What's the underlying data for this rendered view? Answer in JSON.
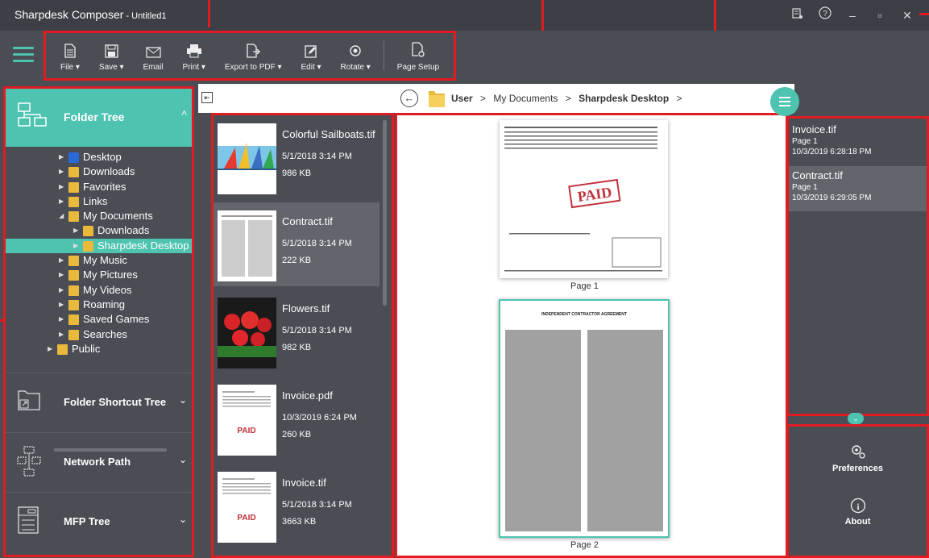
{
  "window": {
    "app_name": "Sharpdesk Composer",
    "doc_name": "- Untitled1",
    "controls": [
      "license-icon",
      "help-icon",
      "minimize-icon",
      "maximize-icon",
      "close-icon"
    ]
  },
  "toolbar": {
    "buttons": [
      {
        "label": "File ▾",
        "icon": "file-icon"
      },
      {
        "label": "Save ▾",
        "icon": "save-icon"
      },
      {
        "label": "Email",
        "icon": "email-icon"
      },
      {
        "label": "Print ▾",
        "icon": "print-icon"
      },
      {
        "label": "Export to PDF ▾",
        "icon": "export-pdf-icon"
      },
      {
        "label": "Edit ▾",
        "icon": "edit-icon"
      },
      {
        "label": "Rotate ▾",
        "icon": "rotate-icon"
      },
      {
        "label": "Page Setup",
        "icon": "page-setup-icon"
      }
    ]
  },
  "left_panel": {
    "folder_tree_label": "Folder Tree",
    "tree": [
      {
        "label": "Desktop",
        "level": 1,
        "selected": false
      },
      {
        "label": "Downloads",
        "level": 1,
        "selected": false
      },
      {
        "label": "Favorites",
        "level": 1,
        "selected": false
      },
      {
        "label": "Links",
        "level": 1,
        "selected": false
      },
      {
        "label": "My Documents",
        "level": 1,
        "selected": false,
        "expanded": true
      },
      {
        "label": "Downloads",
        "level": 2,
        "selected": false
      },
      {
        "label": "Sharpdesk Desktop",
        "level": 2,
        "selected": true
      },
      {
        "label": "My Music",
        "level": 1,
        "selected": false
      },
      {
        "label": "My Pictures",
        "level": 1,
        "selected": false
      },
      {
        "label": "My Videos",
        "level": 1,
        "selected": false
      },
      {
        "label": "Roaming",
        "level": 1,
        "selected": false
      },
      {
        "label": "Saved Games",
        "level": 1,
        "selected": false
      },
      {
        "label": "Searches",
        "level": 1,
        "selected": false
      },
      {
        "label": "Public",
        "level": 0,
        "selected": false
      }
    ],
    "sections": [
      {
        "label": "Folder Shortcut Tree"
      },
      {
        "label": "Network Path"
      },
      {
        "label": "MFP Tree"
      }
    ]
  },
  "breadcrumb": {
    "items": [
      "User",
      "My Documents",
      "Sharpdesk Desktop"
    ],
    "sep": ">"
  },
  "files": [
    {
      "name": "Colorful Sailboats.tif",
      "date": "5/1/2018 3:14 PM",
      "size": "986 KB"
    },
    {
      "name": "Contract.tif",
      "date": "5/1/2018 3:14 PM",
      "size": "222 KB"
    },
    {
      "name": "Flowers.tif",
      "date": "5/1/2018 3:14 PM",
      "size": "982 KB"
    },
    {
      "name": "Invoice.pdf",
      "date": "10/3/2019 6:24 PM",
      "size": "260 KB"
    },
    {
      "name": "Invoice.tif",
      "date": "5/1/2018 3:14 PM",
      "size": "3663 KB"
    }
  ],
  "preview": {
    "pages": [
      "Page 1",
      "Page 2"
    ],
    "stamp": "PAID",
    "doc_title": "INDEPENDENT CONTRACTOR AGREEMENT"
  },
  "recent": [
    {
      "name": "Invoice.tif",
      "page": "Page 1",
      "time": "10/3/2019 6:28:18 PM"
    },
    {
      "name": "Contract.tif",
      "page": "Page 1",
      "time": "10/3/2019 6:29:05 PM"
    }
  ],
  "settings": {
    "preferences": "Preferences",
    "about": "About"
  },
  "colors": {
    "accent": "#4dc3b0",
    "highlight": "#e01b22",
    "panel": "#4a4d53"
  }
}
